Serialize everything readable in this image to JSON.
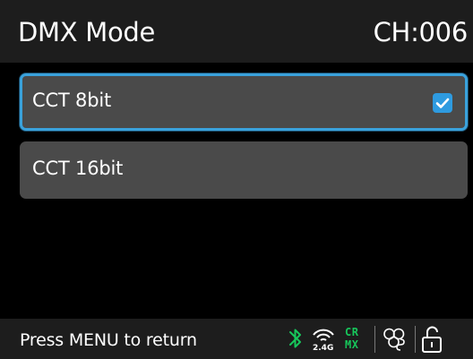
{
  "header": {
    "title": "DMX Mode",
    "channel": "CH:006"
  },
  "options": [
    {
      "label": "CCT 8bit",
      "selected": true
    },
    {
      "label": "CCT 16bit",
      "selected": false
    }
  ],
  "footer": {
    "hint": "Press MENU to return",
    "wifi_band": "2.4G",
    "crmx_top": "CR",
    "crmx_bottom": "MX",
    "icons": [
      "bluetooth-icon",
      "wifi-2.4g-icon",
      "crmx-icon",
      "linked-status-icon",
      "unlock-icon"
    ]
  },
  "colors": {
    "accent": "#3aa2dc",
    "checkbox": "#2e9be0",
    "crmx_green": "#17c75b",
    "bluetooth_green": "#17c75b",
    "bar_bg": "#1d1d1d",
    "option_bg": "#4a4a4a"
  }
}
